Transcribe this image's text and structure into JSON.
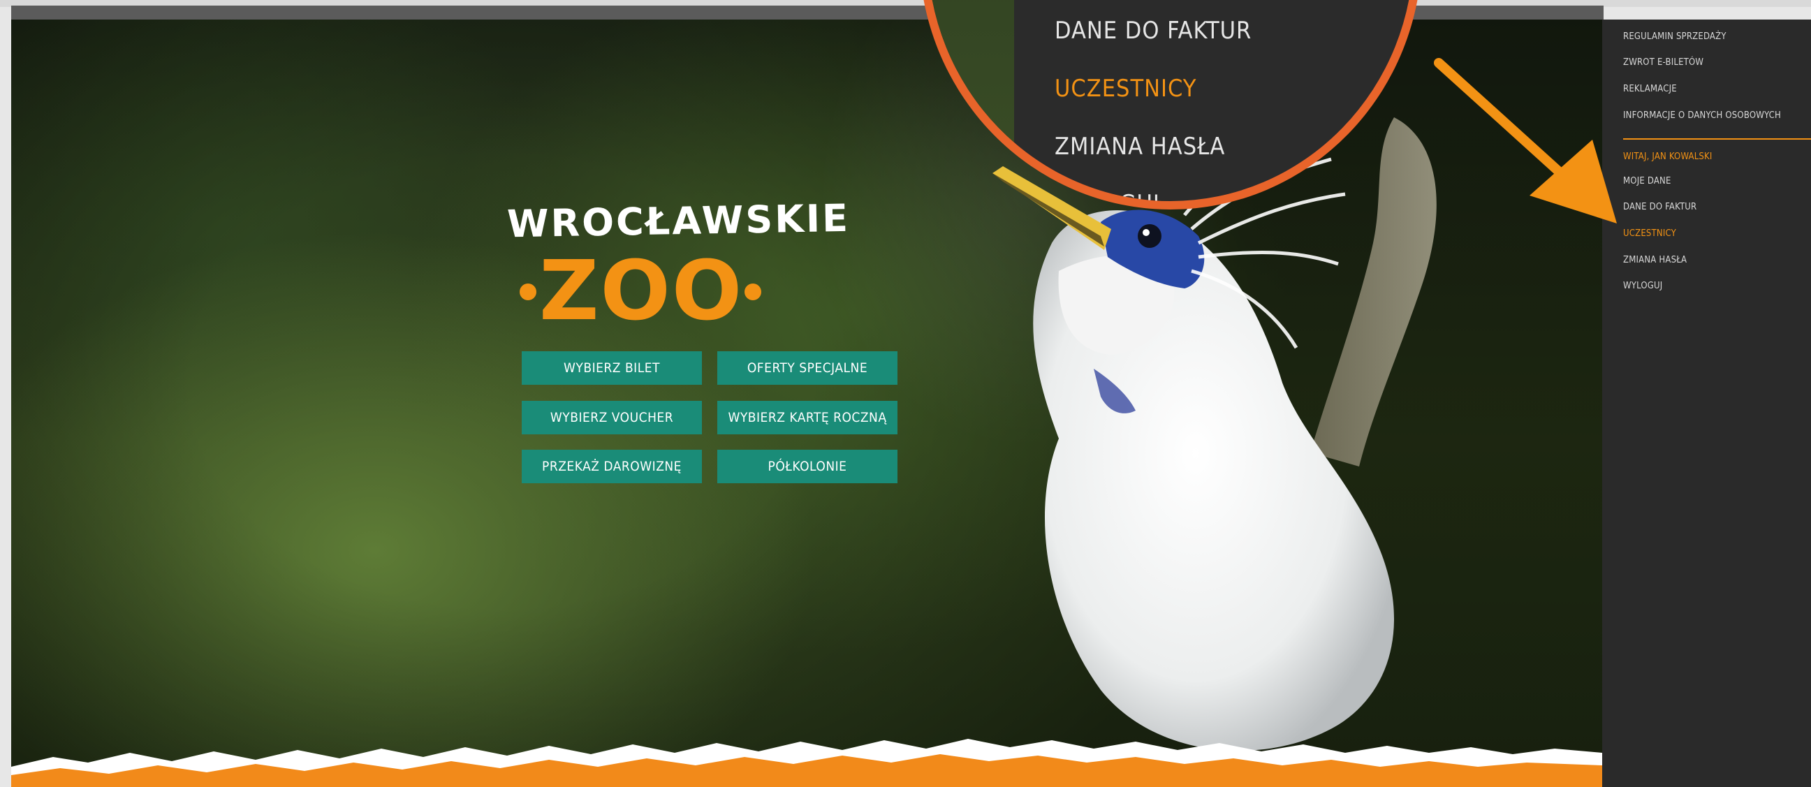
{
  "logo": {
    "line1": "WROCŁAWSKIE",
    "line2": "ZOO"
  },
  "buttons": [
    "WYBIERZ BILET",
    "OFERTY SPECJALNE",
    "WYBIERZ VOUCHER",
    "WYBIERZ KARTĘ ROCZNĄ",
    "PRZEKAŻ DAROWIZNĘ",
    "PÓŁKOLONIE"
  ],
  "menu": {
    "links": [
      "REGULAMIN SPRZEDAŻY",
      "ZWROT E-BILETÓW",
      "REKLAMACJE",
      "INFORMACJE O DANYCH OSOBOWYCH"
    ],
    "greeting": "WITAJ, JAN KOWALSKI",
    "account": [
      "MOJE DANE",
      "DANE DO FAKTUR",
      "UCZESTNICY",
      "ZMIANA HASŁA",
      "WYLOGUJ"
    ],
    "active": "UCZESTNICY"
  },
  "magnifier": {
    "items": [
      "DANE DO FAKTUR",
      "UCZESTNICY",
      "ZMIANA HASŁA",
      "WYLOGUJ"
    ]
  },
  "colors": {
    "accent": "#f39214",
    "button": "#1a8c78",
    "panel": "#2a2a2a",
    "magnifier_ring": "#e8642a"
  }
}
